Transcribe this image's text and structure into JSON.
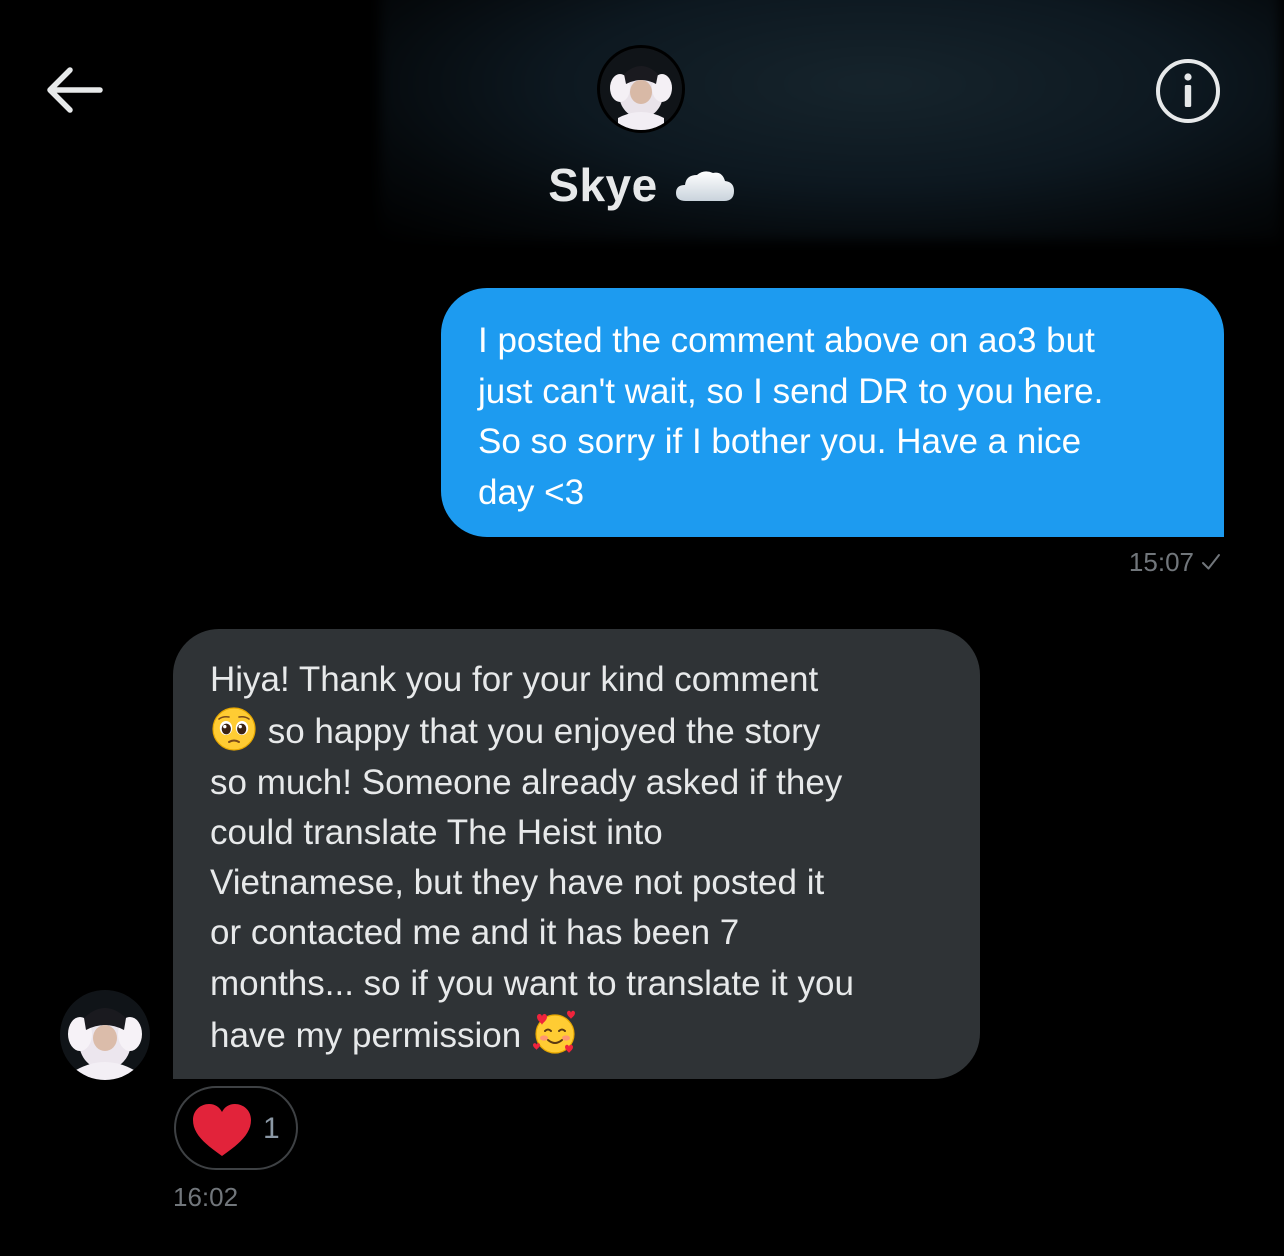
{
  "header": {
    "contact_name": "Skye",
    "back_icon": "arrow-left-icon",
    "info_icon": "info-circle-icon",
    "name_emoji": "cloud-icon"
  },
  "messages": [
    {
      "direction": "sent",
      "text": "I posted the comment above on ao3 but\njust can't wait, so I send DR to you here.\nSo so sorry if I bother you. Have a nice\nday <3",
      "time": "15:07",
      "status_icon": "check-icon"
    },
    {
      "direction": "received",
      "lines": [
        "Hiya! Thank you for your kind comment",
        " so happy that you enjoyed the story",
        "so much! Someone already asked if they",
        "could translate The Heist into",
        "Vietnamese, but they have not posted it",
        "or contacted me and it has been 7",
        "months... so if you want to translate it you",
        "have my permission "
      ],
      "emoji_1": "pleading-face-emoji",
      "emoji_2": "smiling-face-with-hearts-emoji",
      "time": "16:02",
      "reaction": {
        "icon": "heart-icon",
        "count": "1"
      }
    }
  ],
  "colors": {
    "background": "#000000",
    "sent_bubble": "#1d9bf0",
    "received_bubble": "#2f3336",
    "meta_text": "#71767b",
    "heart": "#f91880"
  }
}
